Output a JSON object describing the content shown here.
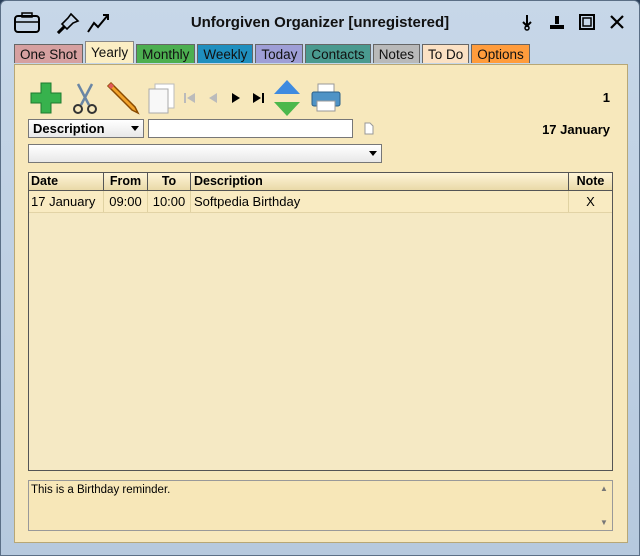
{
  "window": {
    "title": "Unforgiven Organizer [unregistered]"
  },
  "titlebar": {
    "left_icons": [
      "briefcase-icon",
      "pin-icon",
      "chart-icon"
    ],
    "right_icons": [
      "download-icon",
      "minimize-to-tray-icon",
      "maximize-icon",
      "close-icon"
    ]
  },
  "tabs": [
    {
      "label": "One Shot",
      "color": "#d6a0a0"
    },
    {
      "label": "Yearly",
      "color": "#fbeec4",
      "active": true
    },
    {
      "label": "Monthly",
      "color": "#4caf50"
    },
    {
      "label": "Weekly",
      "color": "#1f8fbf"
    },
    {
      "label": "Today",
      "color": "#9e9ed6"
    },
    {
      "label": "Contacts",
      "color": "#4a9a8f"
    },
    {
      "label": "Notes",
      "color": "#b9b9b9"
    },
    {
      "label": "To Do",
      "color": "#fbe1c4"
    },
    {
      "label": "Options",
      "color": "#ff9c3c"
    }
  ],
  "toolbar": {
    "icons": [
      "add-icon",
      "cut-icon",
      "edit-icon",
      "copy-icon",
      "first-icon",
      "prev-icon",
      "next-icon",
      "last-icon",
      "sort-icon",
      "print-icon"
    ],
    "count": "1"
  },
  "filter": {
    "field_select": "Description",
    "search_value": "",
    "selected_date": "17 January",
    "second_select": ""
  },
  "grid": {
    "columns": [
      "Date",
      "From",
      "To",
      "Description",
      "Note"
    ],
    "rows": [
      {
        "date": "17 January",
        "from": "09:00",
        "to": "10:00",
        "description": "Softpedia Birthday",
        "note": "X"
      }
    ]
  },
  "note_text": "This is a Birthday reminder."
}
